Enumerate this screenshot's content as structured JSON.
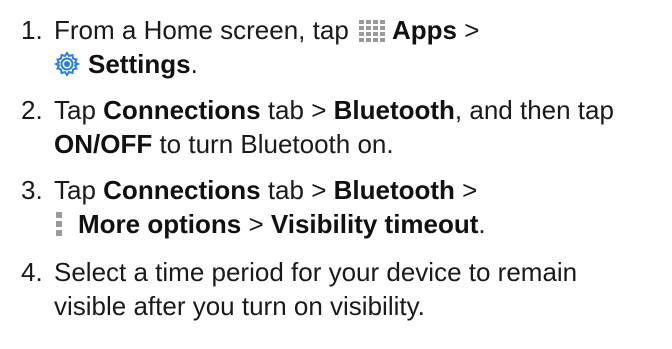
{
  "steps": [
    {
      "number": "1.",
      "lines": [
        {
          "parts": [
            "From a Home screen, tap ",
            "Apps",
            " >"
          ],
          "icon": "apps-grid-icon"
        },
        {
          "parts": [
            "Settings",
            "."
          ],
          "icon": "gear-icon"
        }
      ]
    },
    {
      "number": "2.",
      "lines": [
        {
          "parts": [
            "Tap ",
            "Connections",
            " tab > ",
            "Bluetooth",
            ", and then tap"
          ]
        },
        {
          "parts": [
            "ON/OFF",
            " to turn Bluetooth on."
          ]
        }
      ]
    },
    {
      "number": "3.",
      "lines": [
        {
          "parts": [
            "Tap ",
            "Connections",
            " tab > ",
            "Bluetooth",
            " >"
          ]
        },
        {
          "parts": [
            "More options",
            " > ",
            "Visibility timeout",
            "."
          ],
          "icon": "more-options-icon"
        }
      ]
    },
    {
      "number": "4.",
      "lines": [
        {
          "parts": [
            "Select a time period for your device to remain"
          ]
        },
        {
          "parts": [
            "visible after you turn on visibility."
          ]
        }
      ]
    }
  ],
  "colors": {
    "text": "#1a1a1a",
    "icon_blue": "#2f7fd1",
    "icon_gray": "#9a9a9a"
  }
}
